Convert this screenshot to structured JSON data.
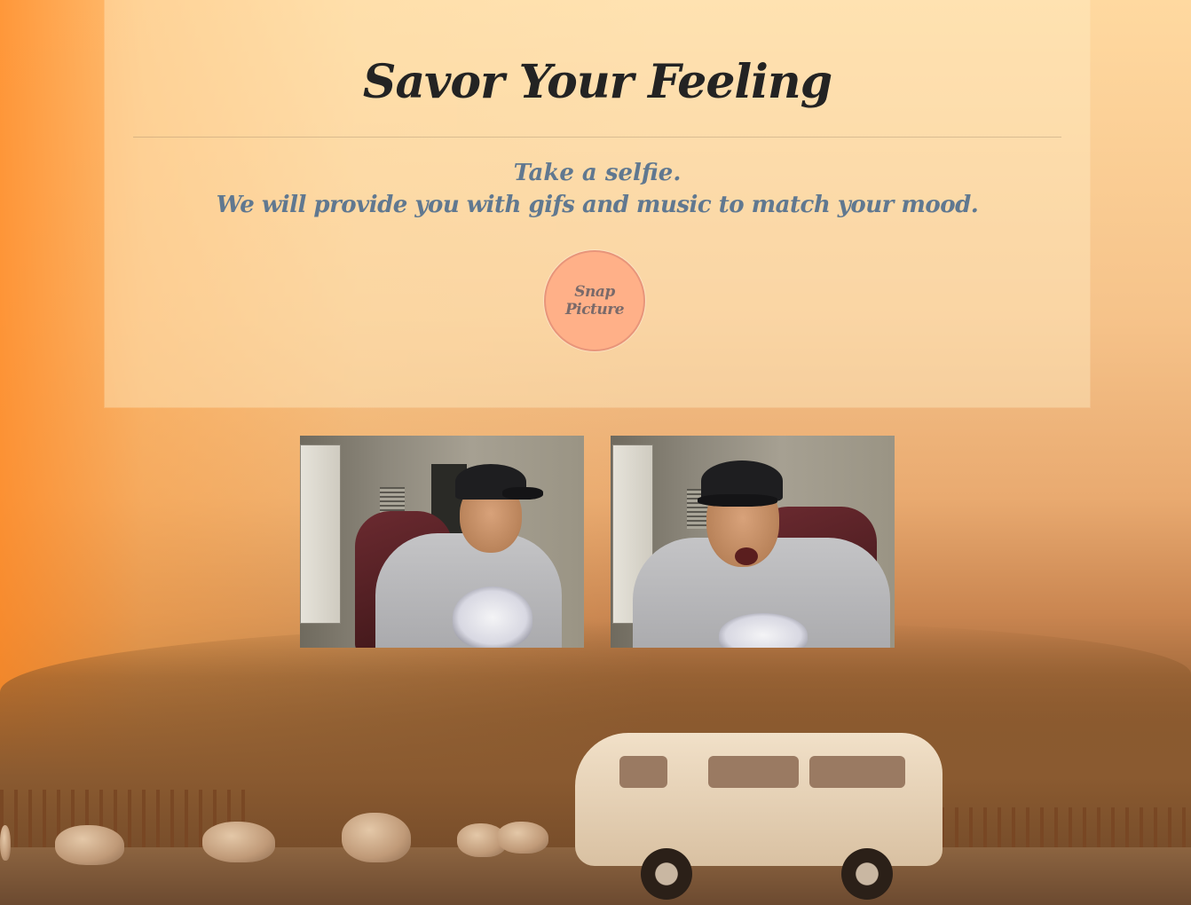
{
  "page": {
    "title": "Savor Your Feeling",
    "subtitle_line1": "Take a selfie.",
    "subtitle_line2": "We will provide you with gifs and music to match your mood.",
    "snap_button_label": "Snap Picture"
  },
  "photos": [
    {
      "description_icon": "webcam-photo"
    },
    {
      "description_icon": "webcam-photo"
    }
  ],
  "colors": {
    "title": "#232323",
    "subtitle": "#607890",
    "button_fill": "#ffb088",
    "button_border": "#e8957a",
    "button_text": "#7a6a6a"
  }
}
